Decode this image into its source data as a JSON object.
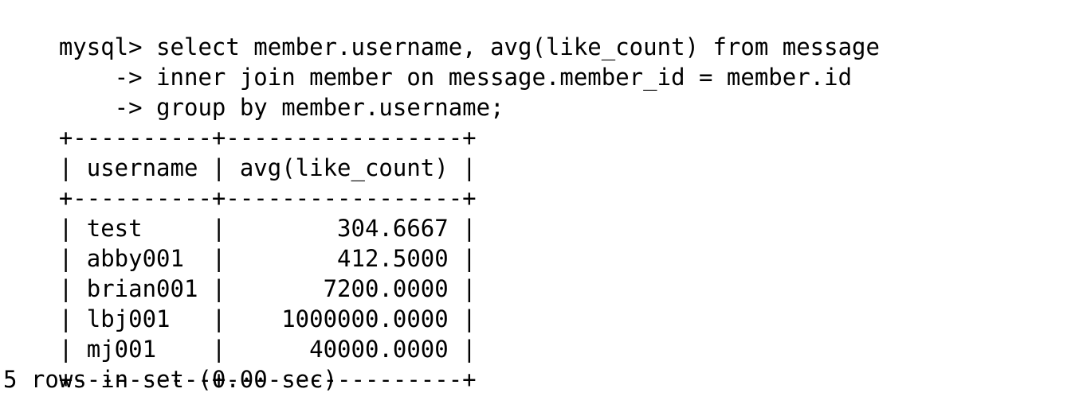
{
  "terminal": {
    "prompt": "mysql> ",
    "query_lines": [
      {
        "prompt": "mysql> ",
        "text": "select member.username, avg(like_count) from message"
      },
      {
        "prompt": "    -> ",
        "text": "inner join member on message.member_id = member.id"
      },
      {
        "prompt": "    -> ",
        "text": "group by member.username;"
      }
    ],
    "table": {
      "border": "+----------+-----------------+",
      "header_row": "| username | avg(like_count) |",
      "columns": [
        "username",
        "avg(like_count)"
      ],
      "rows": [
        {
          "username": "test",
          "avg_like_count": "304.6667",
          "display": "| test     |        304.6667 |"
        },
        {
          "username": "abby001",
          "avg_like_count": "412.5000",
          "display": "| abby001  |        412.5000 |"
        },
        {
          "username": "brian001",
          "avg_like_count": "7200.0000",
          "display": "| brian001 |       7200.0000 |"
        },
        {
          "username": "lbj001",
          "avg_like_count": "1000000.0000",
          "display": "| lbj001   |    1000000.0000 |"
        },
        {
          "username": "mj001",
          "avg_like_count": "40000.0000",
          "display": "| mj001    |      40000.0000 |"
        }
      ]
    },
    "summary": "5 rows in set (0.00 sec)"
  }
}
